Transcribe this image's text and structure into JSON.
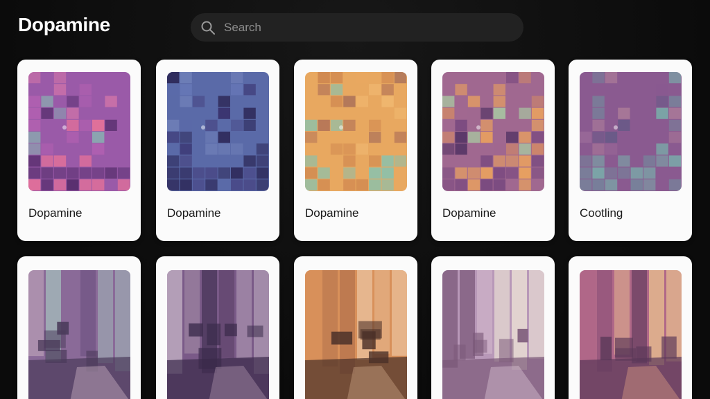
{
  "app": {
    "title": "Dopamine"
  },
  "search": {
    "placeholder": "Search",
    "value": ""
  },
  "cards": [
    {
      "title": "Dopamine",
      "palette": [
        "#9a5aa8",
        "#b060b0",
        "#e0709a",
        "#5a3070",
        "#8aa8b0",
        "#c870a8"
      ]
    },
    {
      "title": "Dopamine",
      "palette": [
        "#5a6aa8",
        "#6878b8",
        "#4a4a88",
        "#2e2a5a",
        "#7080b8",
        "#3a3470"
      ]
    },
    {
      "title": "Dopamine",
      "palette": [
        "#e8a860",
        "#f0b870",
        "#d08850",
        "#90c0a8",
        "#a06858",
        "#b87858"
      ]
    },
    {
      "title": "Dopamine",
      "palette": [
        "#a06890",
        "#d08868",
        "#e8a060",
        "#7a4a80",
        "#a8c0a0",
        "#5a3868"
      ]
    },
    {
      "title": "Cootling",
      "palette": [
        "#8a5a90",
        "#9a6a98",
        "#78809a",
        "#7aa8a8",
        "#a87898",
        "#6a5a88"
      ]
    }
  ],
  "row2_cards": [
    {
      "palette": [
        "#8a6a98",
        "#6a5080",
        "#a8c8c0",
        "#4a3a5a",
        "#c8b0c0"
      ]
    },
    {
      "palette": [
        "#7a5a88",
        "#5a4068",
        "#c8b8c8",
        "#3a2a4a",
        "#a890a8"
      ]
    },
    {
      "palette": [
        "#d8905a",
        "#a86848",
        "#f0d0b0",
        "#4a3028",
        "#c8a080"
      ]
    },
    {
      "palette": [
        "#b898b8",
        "#9a7898",
        "#f0e8d8",
        "#7a5878",
        "#d8c0d0"
      ]
    },
    {
      "palette": [
        "#b06888",
        "#8a5078",
        "#f0c890",
        "#5a3858",
        "#d89880"
      ]
    }
  ]
}
